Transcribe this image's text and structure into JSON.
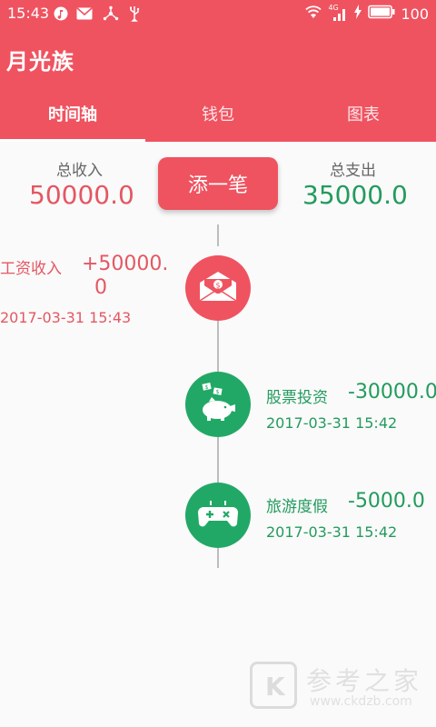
{
  "status_bar": {
    "time": "15:43",
    "network": "4G",
    "battery": "100"
  },
  "app": {
    "title": "月光族"
  },
  "tabs": [
    {
      "label": "时间轴",
      "active": true
    },
    {
      "label": "钱包",
      "active": false
    },
    {
      "label": "图表",
      "active": false
    }
  ],
  "summary": {
    "income_label": "总收入",
    "income_value": "50000.0",
    "expense_label": "总支出",
    "expense_value": "35000.0",
    "add_button": "添一笔"
  },
  "timeline": [
    {
      "type": "income",
      "name": "工资收入",
      "amount": "+50000.",
      "amount_wrap": "0",
      "time": "2017-03-31   15:43",
      "icon": "envelope-money-icon"
    },
    {
      "type": "expense",
      "name": "股票投资",
      "amount": "-30000.0",
      "time": "2017-03-31   15:42",
      "icon": "piggy-bank-icon"
    },
    {
      "type": "expense",
      "name": "旅游度假",
      "amount": "-5000.0",
      "time": "2017-03-31   15:42",
      "icon": "gamepad-icon"
    }
  ],
  "watermark": {
    "logo": "K",
    "title": "参考之家",
    "url": "www.ckdzb.com"
  },
  "colors": {
    "primary": "#ef5360",
    "income": "#e45762",
    "expense": "#239b5e",
    "node_green": "#22a866"
  }
}
